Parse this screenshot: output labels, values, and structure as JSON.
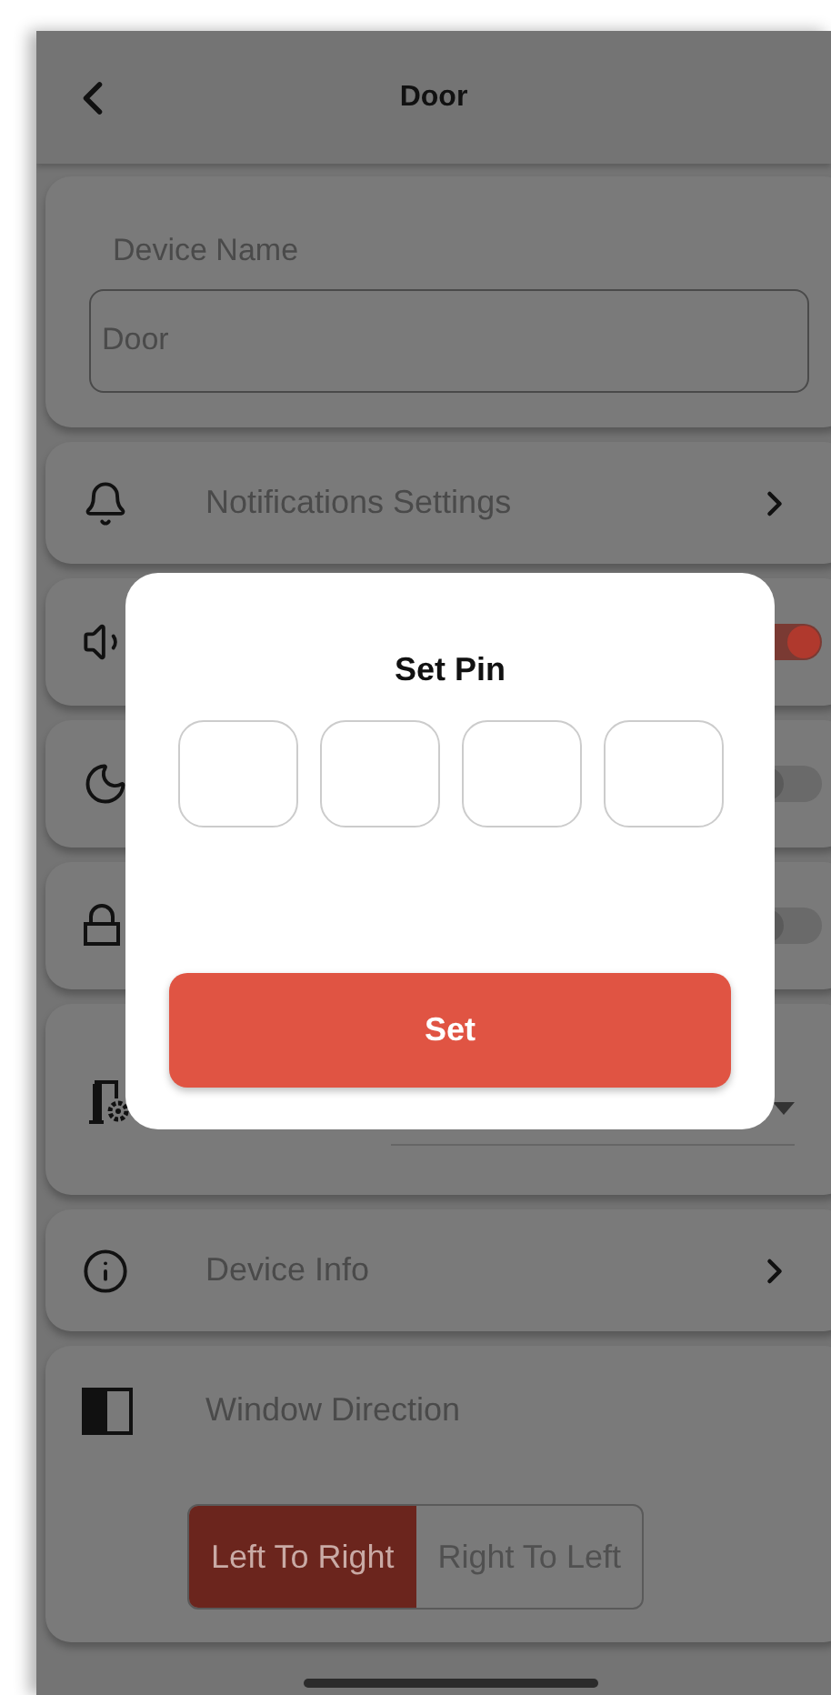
{
  "header": {
    "title": "Door"
  },
  "device_name": {
    "label": "Device Name",
    "value": "Door"
  },
  "settings": [
    {
      "kind": "link",
      "label": "Notifications Settings"
    },
    {
      "kind": "toggle",
      "on": true
    },
    {
      "kind": "toggle",
      "on": false
    },
    {
      "kind": "toggle",
      "on": false
    },
    {
      "kind": "dropdown"
    },
    {
      "kind": "link",
      "label": "Device Info"
    },
    {
      "kind": "segmented",
      "label": "Window Direction",
      "options": [
        {
          "label": "Left To Right",
          "selected": true
        },
        {
          "label": "Right To Left",
          "selected": false
        }
      ]
    }
  ],
  "dialog": {
    "title": "Set Pin",
    "pin_fields": [
      {
        "filled": false
      },
      {
        "filled": false
      },
      {
        "filled": false
      },
      {
        "filled": false
      }
    ],
    "button": "Set"
  }
}
